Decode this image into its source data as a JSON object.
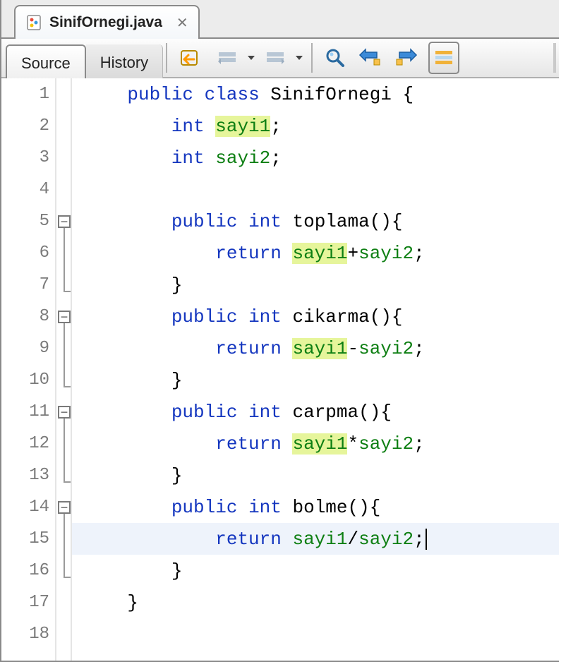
{
  "file_tab": {
    "name": "SinifOrnegi.java",
    "close_char": "✕"
  },
  "toolbar": {
    "source_label": "Source",
    "history_label": "History"
  },
  "editor": {
    "line_height": 45,
    "line_count": 18,
    "current_line_index": 15,
    "fold_boxes": [
      5,
      8,
      11,
      14
    ],
    "fold_brackets": [
      {
        "start": 5,
        "end": 7
      },
      {
        "start": 8,
        "end": 10
      },
      {
        "start": 11,
        "end": 13
      },
      {
        "start": 14,
        "end": 16
      }
    ],
    "lines": [
      {
        "tokens": [
          {
            "t": "    ",
            "c": ""
          },
          {
            "t": "public",
            "c": "kw"
          },
          {
            "t": " ",
            "c": ""
          },
          {
            "t": "class",
            "c": "kw"
          },
          {
            "t": " ",
            "c": ""
          },
          {
            "t": "SinifOrnegi",
            "c": "id"
          },
          {
            "t": " {",
            "c": "punc"
          }
        ]
      },
      {
        "tokens": [
          {
            "t": "        ",
            "c": ""
          },
          {
            "t": "int",
            "c": "kw"
          },
          {
            "t": " ",
            "c": ""
          },
          {
            "t": "sayi1",
            "c": "fld hl"
          },
          {
            "t": ";",
            "c": "punc"
          }
        ]
      },
      {
        "tokens": [
          {
            "t": "        ",
            "c": ""
          },
          {
            "t": "int",
            "c": "kw"
          },
          {
            "t": " ",
            "c": ""
          },
          {
            "t": "sayi2",
            "c": "fld"
          },
          {
            "t": ";",
            "c": "punc"
          }
        ]
      },
      {
        "tokens": []
      },
      {
        "tokens": [
          {
            "t": "        ",
            "c": ""
          },
          {
            "t": "public",
            "c": "kw"
          },
          {
            "t": " ",
            "c": ""
          },
          {
            "t": "int",
            "c": "kw"
          },
          {
            "t": " ",
            "c": ""
          },
          {
            "t": "toplama",
            "c": "id"
          },
          {
            "t": "(){",
            "c": "punc"
          }
        ]
      },
      {
        "tokens": [
          {
            "t": "            ",
            "c": ""
          },
          {
            "t": "return",
            "c": "kw"
          },
          {
            "t": " ",
            "c": ""
          },
          {
            "t": "sayi1",
            "c": "fld hl"
          },
          {
            "t": "+",
            "c": "punc"
          },
          {
            "t": "sayi2",
            "c": "fld"
          },
          {
            "t": ";",
            "c": "punc"
          }
        ]
      },
      {
        "tokens": [
          {
            "t": "        ",
            "c": ""
          },
          {
            "t": "}",
            "c": "punc"
          }
        ]
      },
      {
        "tokens": [
          {
            "t": "        ",
            "c": ""
          },
          {
            "t": "public",
            "c": "kw"
          },
          {
            "t": " ",
            "c": ""
          },
          {
            "t": "int",
            "c": "kw"
          },
          {
            "t": " ",
            "c": ""
          },
          {
            "t": "cikarma",
            "c": "id"
          },
          {
            "t": "(){",
            "c": "punc"
          }
        ]
      },
      {
        "tokens": [
          {
            "t": "            ",
            "c": ""
          },
          {
            "t": "return",
            "c": "kw"
          },
          {
            "t": " ",
            "c": ""
          },
          {
            "t": "sayi1",
            "c": "fld hl"
          },
          {
            "t": "-",
            "c": "punc"
          },
          {
            "t": "sayi2",
            "c": "fld"
          },
          {
            "t": ";",
            "c": "punc"
          }
        ]
      },
      {
        "tokens": [
          {
            "t": "        ",
            "c": ""
          },
          {
            "t": "}",
            "c": "punc"
          }
        ]
      },
      {
        "tokens": [
          {
            "t": "        ",
            "c": ""
          },
          {
            "t": "public",
            "c": "kw"
          },
          {
            "t": " ",
            "c": ""
          },
          {
            "t": "int",
            "c": "kw"
          },
          {
            "t": " ",
            "c": ""
          },
          {
            "t": "carpma",
            "c": "id"
          },
          {
            "t": "(){",
            "c": "punc"
          }
        ]
      },
      {
        "tokens": [
          {
            "t": "            ",
            "c": ""
          },
          {
            "t": "return",
            "c": "kw"
          },
          {
            "t": " ",
            "c": ""
          },
          {
            "t": "sayi1",
            "c": "fld hl"
          },
          {
            "t": "*",
            "c": "punc"
          },
          {
            "t": "sayi2",
            "c": "fld"
          },
          {
            "t": ";",
            "c": "punc"
          }
        ]
      },
      {
        "tokens": [
          {
            "t": "        ",
            "c": ""
          },
          {
            "t": "}",
            "c": "punc"
          }
        ]
      },
      {
        "tokens": [
          {
            "t": "        ",
            "c": ""
          },
          {
            "t": "public",
            "c": "kw"
          },
          {
            "t": " ",
            "c": ""
          },
          {
            "t": "int",
            "c": "kw"
          },
          {
            "t": " ",
            "c": ""
          },
          {
            "t": "bolme",
            "c": "id"
          },
          {
            "t": "(){",
            "c": "punc"
          }
        ]
      },
      {
        "tokens": [
          {
            "t": "            ",
            "c": ""
          },
          {
            "t": "return",
            "c": "kw"
          },
          {
            "t": " ",
            "c": ""
          },
          {
            "t": "sayi1",
            "c": "fld"
          },
          {
            "t": "/",
            "c": "punc"
          },
          {
            "t": "sayi2",
            "c": "fld"
          },
          {
            "t": ";",
            "c": "punc"
          }
        ],
        "caret": true
      },
      {
        "tokens": [
          {
            "t": "        ",
            "c": ""
          },
          {
            "t": "}",
            "c": "punc"
          }
        ]
      },
      {
        "tokens": [
          {
            "t": "    ",
            "c": ""
          },
          {
            "t": "}",
            "c": "punc"
          }
        ]
      },
      {
        "tokens": []
      }
    ]
  }
}
